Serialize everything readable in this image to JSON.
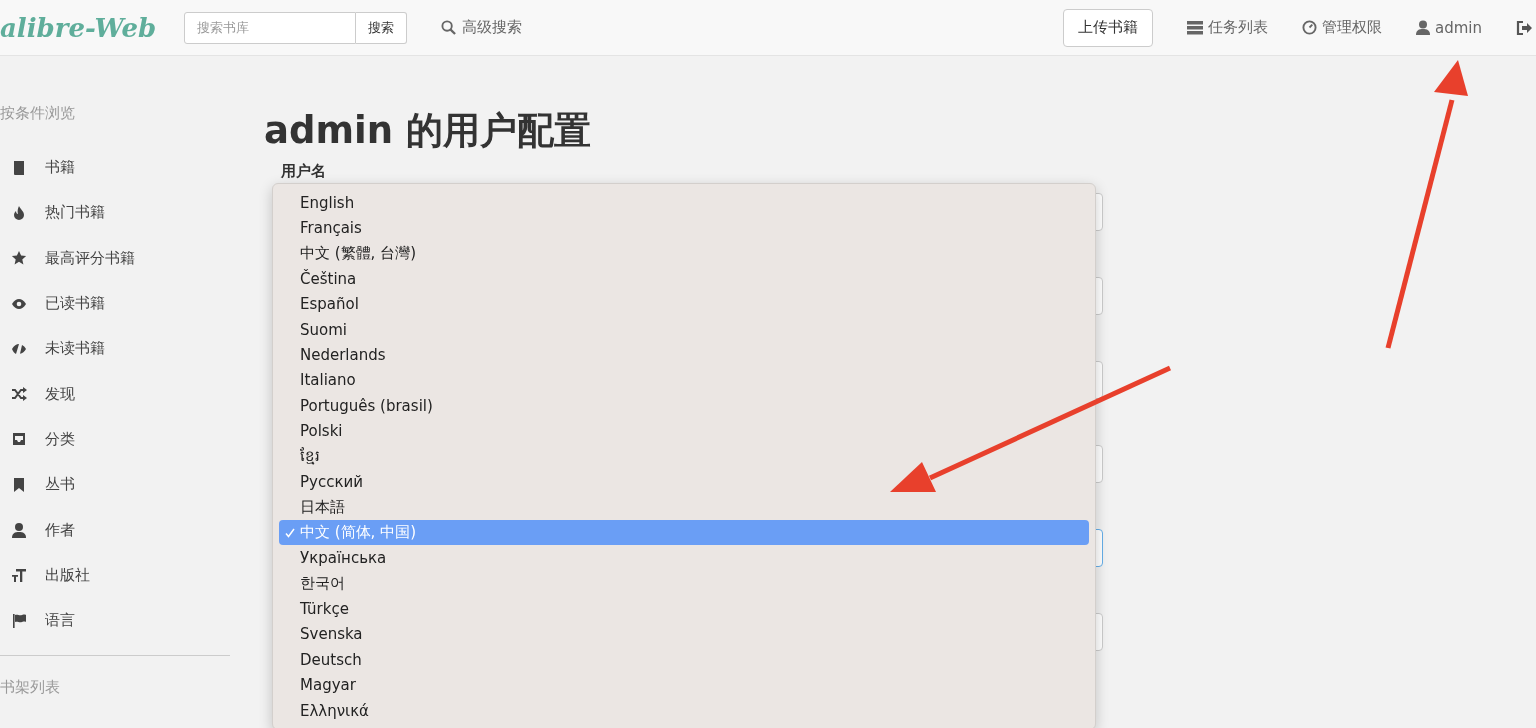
{
  "navbar": {
    "logo": "alibre-Web",
    "search": {
      "placeholder": "搜索书库",
      "button": "搜索"
    },
    "advanced_search": "高级搜索",
    "upload": "上传书籍",
    "links": [
      {
        "kind": "tasks",
        "label": "任务列表"
      },
      {
        "kind": "admin",
        "label": "管理权限"
      },
      {
        "kind": "user",
        "label": "admin"
      },
      {
        "kind": "logout"
      }
    ]
  },
  "sidebar": {
    "heading": "按条件浏览",
    "items": [
      {
        "kind": "book",
        "label": "书籍"
      },
      {
        "kind": "fire",
        "label": "热门书籍"
      },
      {
        "kind": "star",
        "label": "最高评分书籍"
      },
      {
        "kind": "eye",
        "label": "已读书籍"
      },
      {
        "kind": "eye-slash",
        "label": "未读书籍"
      },
      {
        "kind": "shuffle",
        "label": "发现"
      },
      {
        "kind": "inbox",
        "label": "分类"
      },
      {
        "kind": "bookmark",
        "label": "丛书"
      },
      {
        "kind": "user",
        "label": "作者"
      },
      {
        "kind": "text",
        "label": "出版社"
      },
      {
        "kind": "flag",
        "label": "语言"
      }
    ],
    "shelves_heading": "书架列表"
  },
  "page": {
    "title": "admin 的用户配置",
    "field_label": "用户名"
  },
  "language_menu": {
    "options": [
      {
        "label": "English",
        "selected": false
      },
      {
        "label": "Français",
        "selected": false
      },
      {
        "label": "中文 (繁體, 台灣)",
        "selected": false
      },
      {
        "label": "Čeština",
        "selected": false
      },
      {
        "label": "Español",
        "selected": false
      },
      {
        "label": "Suomi",
        "selected": false
      },
      {
        "label": "Nederlands",
        "selected": false
      },
      {
        "label": "Italiano",
        "selected": false
      },
      {
        "label": "Português (brasil)",
        "selected": false
      },
      {
        "label": "Polski",
        "selected": false
      },
      {
        "label": "ខ្មែរ",
        "selected": false
      },
      {
        "label": "Русский",
        "selected": false
      },
      {
        "label": "日本語",
        "selected": false
      },
      {
        "label": "中文 (简体, 中国)",
        "selected": true
      },
      {
        "label": "Українська",
        "selected": false
      },
      {
        "label": "한국어",
        "selected": false
      },
      {
        "label": "Türkçe",
        "selected": false
      },
      {
        "label": "Svenska",
        "selected": false
      },
      {
        "label": "Deutsch",
        "selected": false
      },
      {
        "label": "Magyar",
        "selected": false
      },
      {
        "label": "Ελληνικά",
        "selected": false
      }
    ]
  }
}
